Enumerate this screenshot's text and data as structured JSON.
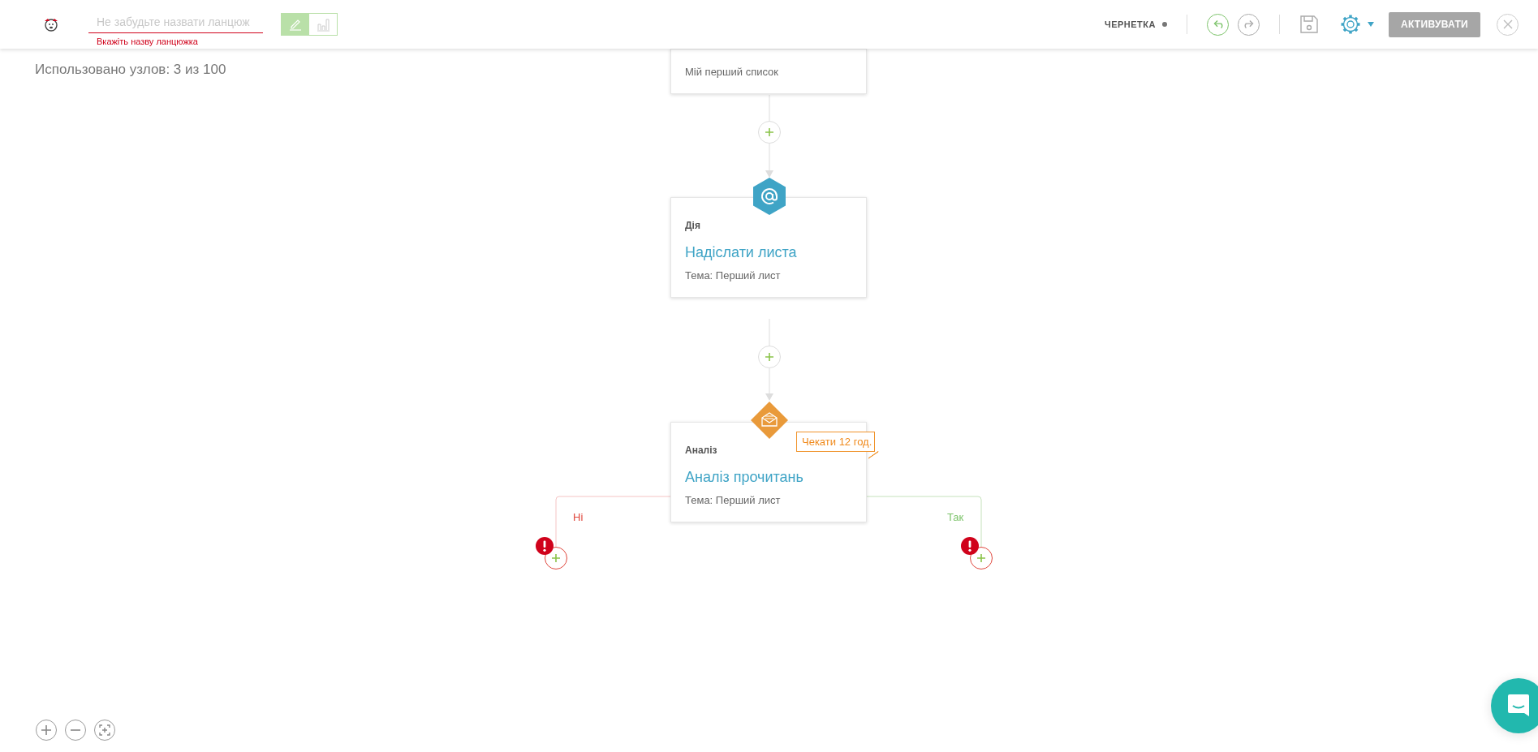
{
  "header": {
    "chain_name": {
      "placeholder": "Не забудьте назвати ланцюж",
      "error": "Вкажіть назву ланцюжка"
    },
    "view_toggle": [
      {
        "kind": "editor",
        "selected": true
      },
      {
        "kind": "stats",
        "selected": false
      }
    ],
    "status": "ЧЕРНЕТКА",
    "undo": {
      "disabled": false
    },
    "redo": {
      "disabled": true
    },
    "activate_button": {
      "label": "АКТИВУВАТИ",
      "disabled": true
    }
  },
  "node_usage": "Использовано узлов: 3 из 100",
  "nodes": [
    {
      "kind": "list",
      "detail": "Мій перший список"
    },
    {
      "kind": "action",
      "category": "Дія",
      "title": "Надіслати листа",
      "detail": "Тема: Перший лист"
    },
    {
      "kind": "condition",
      "category": "Аналіз",
      "title": "Аналіз прочитань",
      "detail": "Тема: Перший лист",
      "wait": "Чекати 12 год."
    }
  ],
  "branches": [
    {
      "kind": "no",
      "label": "Ні",
      "error": true
    },
    {
      "kind": "yes",
      "label": "Так",
      "error": true
    }
  ]
}
